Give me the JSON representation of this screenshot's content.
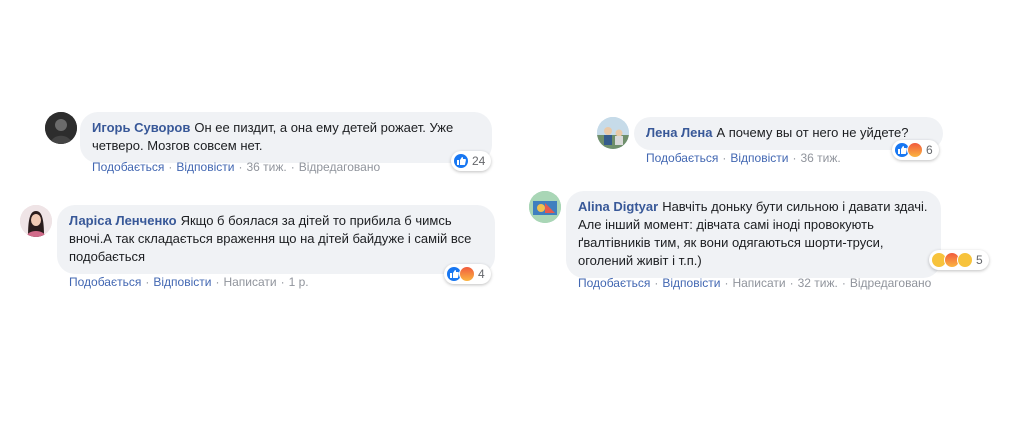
{
  "comments": [
    {
      "author": "Игорь Суворов",
      "text": "Он ее пиздит, а она ему детей рожает. Уже четверо. Мозгов совсем нет.",
      "actions": {
        "like": "Подобається",
        "reply": "Відповісти",
        "time": "36 тиж.",
        "edited": "Відредаговано"
      },
      "reactions": {
        "icons": [
          "like-icon"
        ],
        "count": "24"
      }
    },
    {
      "author": "Ларіса Ленченко",
      "text": "Якщо б боялася за дітей то прибила б чимсь вночі.А так складається враження що на дітей байдуже і самій все подобається",
      "actions": {
        "like": "Подобається",
        "reply": "Відповісти",
        "write": "Написати",
        "time": "1 р."
      },
      "reactions": {
        "icons": [
          "like-icon",
          "angry-icon"
        ],
        "count": "4"
      }
    },
    {
      "author": "Лена Лена",
      "text": "А почему вы от него не уйдете?",
      "actions": {
        "like": "Подобається",
        "reply": "Відповісти",
        "time": "36 тиж."
      },
      "reactions": {
        "icons": [
          "like-icon",
          "angry-icon"
        ],
        "count": "6"
      }
    },
    {
      "author": "Alina Digtyar",
      "text": "Навчіть доньку бути сильною і давати здачі. Але інший момент: дівчата самі іноді провокують ґвалтівників тим, як вони одягаються шорти-труси, оголений живіт і т.п.)",
      "actions": {
        "like": "Подобається",
        "reply": "Відповісти",
        "write": "Написати",
        "time": "32 тиж.",
        "edited": "Відредаговано"
      },
      "reactions": {
        "icons": [
          "sad-icon",
          "angry-icon",
          "wow-icon"
        ],
        "count": "5"
      }
    }
  ],
  "colors": {
    "link": "#4267b2",
    "author": "#385898",
    "bubble": "#f0f2f5",
    "meta": "#90949c"
  }
}
